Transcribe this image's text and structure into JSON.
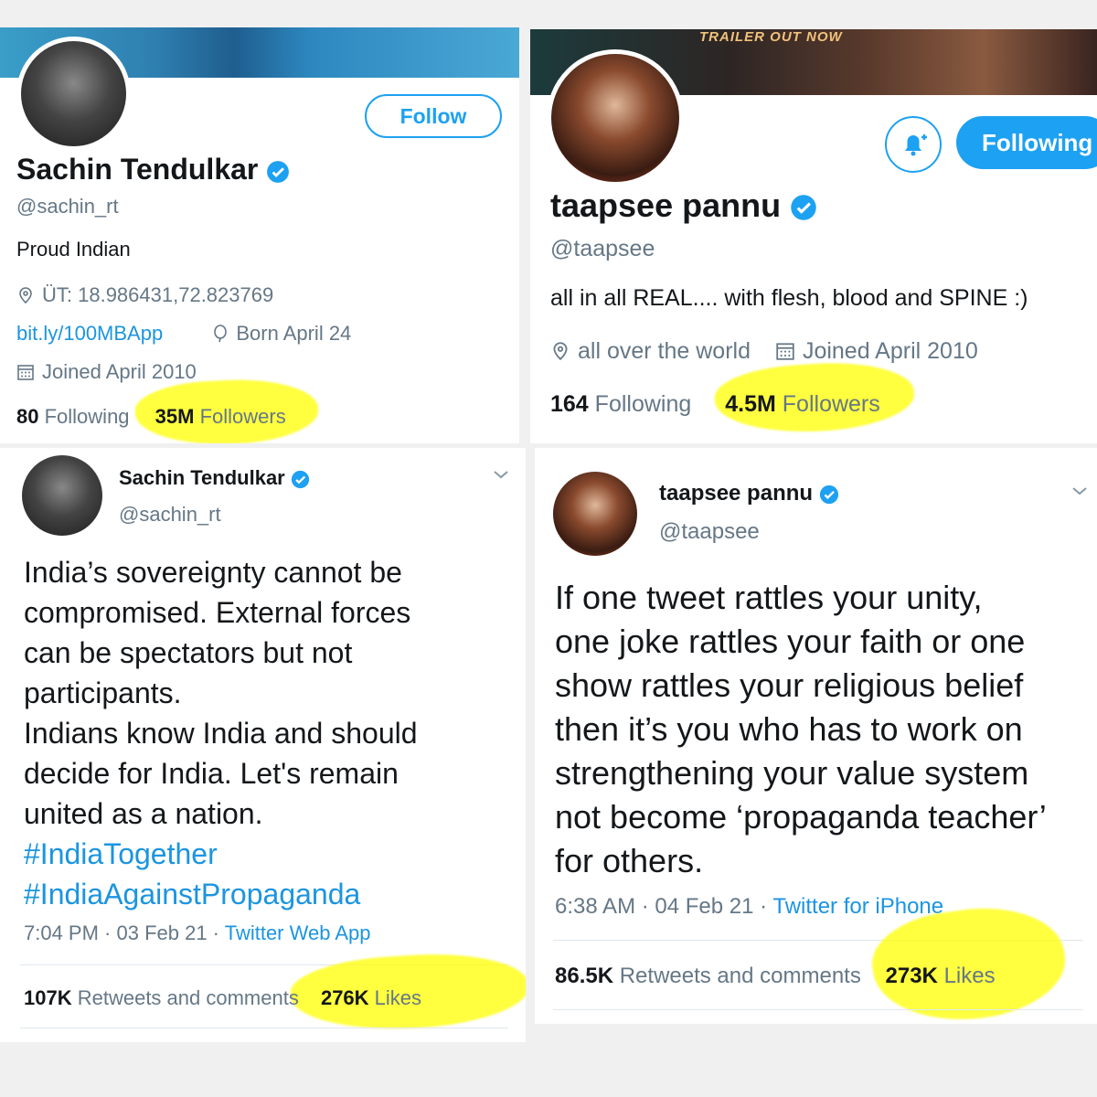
{
  "sachin_profile": {
    "name": "Sachin Tendulkar",
    "handle": "@sachin_rt",
    "follow_label": "Follow",
    "bio": "Proud Indian",
    "location": "ÜT: 18.986431,72.823769",
    "link": "bit.ly/100MBApp",
    "birthday": "Born April 24",
    "joined": "Joined April 2010",
    "following_count": "80",
    "following_label": "Following",
    "followers_count": "35M",
    "followers_label": "Followers"
  },
  "taapsee_profile": {
    "banner_text": "TRAILER OUT NOW",
    "name": "taapsee pannu",
    "handle": "@taapsee",
    "following_button_label": "Following",
    "bio": "all in all REAL.... with flesh, blood and SPINE :)",
    "location": "all over the world",
    "joined": "Joined April 2010",
    "following_count": "164",
    "following_label": "Following",
    "followers_count": "4.5M",
    "followers_label": "Followers"
  },
  "sachin_tweet": {
    "name": "Sachin Tendulkar",
    "handle": "@sachin_rt",
    "text_lines": [
      "India’s sovereignty cannot be",
      "compromised. External forces",
      "can be spectators but not",
      "participants.",
      "Indians know India and should",
      "decide for India. Let's remain",
      "united as a nation."
    ],
    "hashtags": [
      "#IndiaTogether",
      "#IndiaAgainstPropaganda"
    ],
    "time": "7:04 PM · 03 Feb 21 · ",
    "source": "Twitter Web App",
    "retweets_count": "107K",
    "retweets_label": "Retweets and comments",
    "likes_count": "276K",
    "likes_label": "Likes"
  },
  "taapsee_tweet": {
    "name": "taapsee pannu",
    "handle": "@taapsee",
    "text_lines": [
      "If one tweet rattles your unity,",
      "one joke rattles your faith or one",
      "show rattles your religious belief",
      "then it’s you who has to work on",
      "strengthening your value system",
      "not become ‘propaganda teacher’",
      "for others."
    ],
    "time": "6:38 AM · 04 Feb 21 · ",
    "source": "Twitter for iPhone",
    "retweets_count": "86.5K",
    "retweets_label": "Retweets and comments",
    "likes_count": "273K",
    "likes_label": "Likes"
  },
  "colors": {
    "twitter_blue": "#1da1f2",
    "highlight": "#ffff00"
  },
  "icons": [
    "verified-badge-icon",
    "location-pin-icon",
    "balloon-icon",
    "calendar-icon",
    "bell-plus-icon",
    "chevron-down-icon"
  ]
}
